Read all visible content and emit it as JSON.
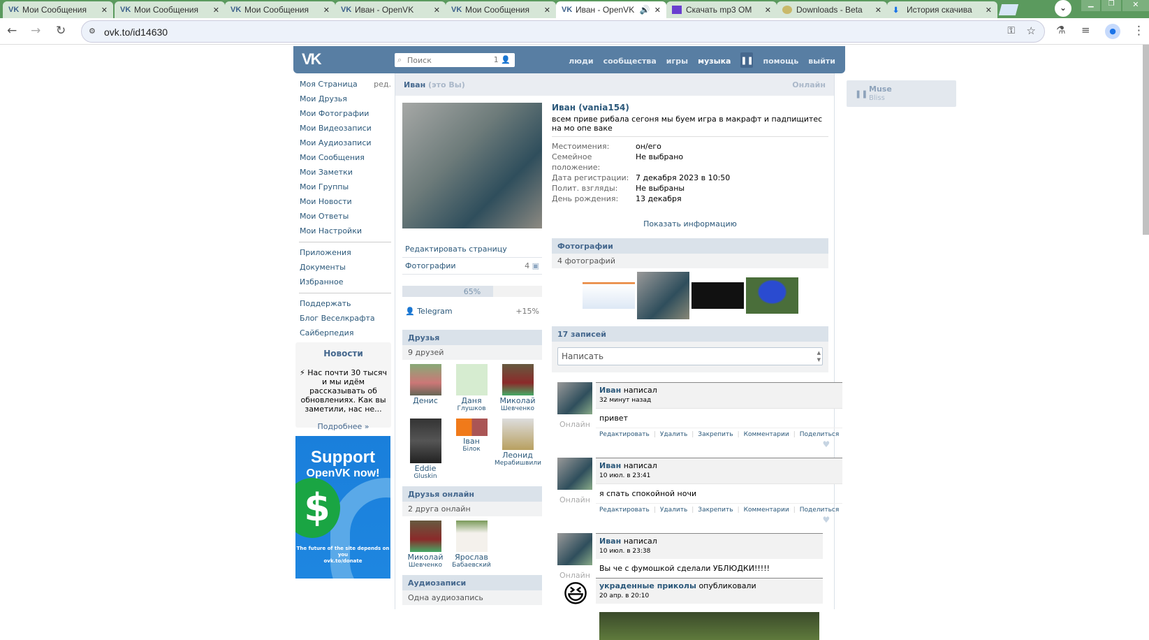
{
  "browser": {
    "tabs": [
      {
        "title": "Мои Сообщения",
        "active": false
      },
      {
        "title": "Мои Сообщения",
        "active": false
      },
      {
        "title": "Мои Сообщения",
        "active": false
      },
      {
        "title": "Иван - OpenVK",
        "active": false
      },
      {
        "title": "Мои Сообщения",
        "active": false
      },
      {
        "title": "Иван - OpenVK",
        "active": true
      },
      {
        "title": "Скачать mp3 OM",
        "active": false
      },
      {
        "title": "Downloads - Beta",
        "active": false
      },
      {
        "title": "История скачива",
        "active": false
      }
    ],
    "url": "ovk.to/id14630"
  },
  "header": {
    "logo": "VK",
    "search_placeholder": "Поиск",
    "search_count": "1",
    "nav": [
      "люди",
      "сообщества",
      "игры",
      "музыка",
      "помощь",
      "выйти"
    ]
  },
  "leftnav": {
    "items": [
      "Моя Страница",
      "Мои Друзья",
      "Мои Фотографии",
      "Мои Видеозаписи",
      "Мои Аудиозаписи",
      "Мои Сообщения",
      "Мои Заметки",
      "Мои Группы",
      "Мои Новости",
      "Мои Ответы",
      "Мои Настройки"
    ],
    "edit": "ред.",
    "items2": [
      "Приложения",
      "Документы",
      "Избранное"
    ],
    "items3": [
      "Поддержать",
      "Блог Веселкрафта",
      "Сайберпедия"
    ]
  },
  "news": {
    "title": "Новости",
    "text": "⚡ Нас почти 30 тысяч и мы идём рассказывать об обновлениях. Как вы заметили, нас не...",
    "more": "Подробнее »"
  },
  "ad": {
    "line1": "Support",
    "line2": "OpenVK now!",
    "line3": "The future of the site depends on you",
    "line4": "ovk.to/donate"
  },
  "profile": {
    "title_name": "Иван",
    "title_you": "(это Вы)",
    "online": "Онлайн",
    "name": "Иван (vania154)",
    "status": "всем приве рибала сегоня мы буем игра в макрафт и падпищитес на мо опе ваке",
    "info": [
      {
        "k": "Местоимения:",
        "v": "он/его"
      },
      {
        "k": "Семейное положение:",
        "v": "Не выбрано"
      },
      {
        "k": "Дата регистрации:",
        "v": "7 декабря 2023 в 10:50"
      },
      {
        "k": "Полит. взгляды:",
        "v": "Не выбраны"
      },
      {
        "k": "День рождения:",
        "v": "13 декабря"
      }
    ],
    "show_info": "Показать информацию",
    "edit_page": "Редактировать страницу",
    "photos_link": "Фотографии",
    "photos_count": "4",
    "completeness": "65%",
    "completeness_value": 65,
    "telegram": "Telegram",
    "telegram_bonus": "+15%"
  },
  "friends": {
    "title": "Друзья",
    "count": "9 друзей",
    "items": [
      {
        "a": "Денис",
        "b": ""
      },
      {
        "a": "Даня",
        "b": "Глушков"
      },
      {
        "a": "Миколай",
        "b": "Шевченко"
      },
      {
        "a": "Eddie",
        "b": "Gluskin"
      },
      {
        "a": "Іван",
        "b": "Білок"
      },
      {
        "a": "Леонид",
        "b": "Мерабишвили"
      }
    ]
  },
  "friends_online": {
    "title": "Друзья онлайн",
    "count": "2 друга онлайн",
    "items": [
      {
        "a": "Миколай",
        "b": "Шевченко"
      },
      {
        "a": "Ярослав",
        "b": "Бабаевский"
      }
    ]
  },
  "audio": {
    "title": "Аудиозаписи",
    "count": "Одна аудиозапись"
  },
  "photos": {
    "title": "Фотографии",
    "count": "4 фотографий"
  },
  "wall": {
    "title": "17 записей",
    "placeholder": "Написать",
    "actions": [
      "Редактировать",
      "Удалить",
      "Закрепить",
      "Комментарии",
      "Поделиться"
    ],
    "posts": [
      {
        "author": "Иван",
        "verb": "написал",
        "date": "32 минут назад",
        "text": "привет",
        "online": "Онлайн"
      },
      {
        "author": "Иван",
        "verb": "написал",
        "date": "10 июл. в 23:41",
        "text": "я спать спокойной ночи",
        "online": "Онлайн"
      },
      {
        "author": "Иван",
        "verb": "написал",
        "date": "10 июл. в 23:38",
        "text": "Вы че с фумошкой сделали УБЛЮДКИ!!!!!",
        "online": "Онлайн",
        "repost": {
          "author": "украденные приколы",
          "verb": "опубликовали",
          "date": "20 апр. в 20:10"
        }
      }
    ]
  },
  "player": {
    "artist": "Muse",
    "track": "Bliss"
  }
}
